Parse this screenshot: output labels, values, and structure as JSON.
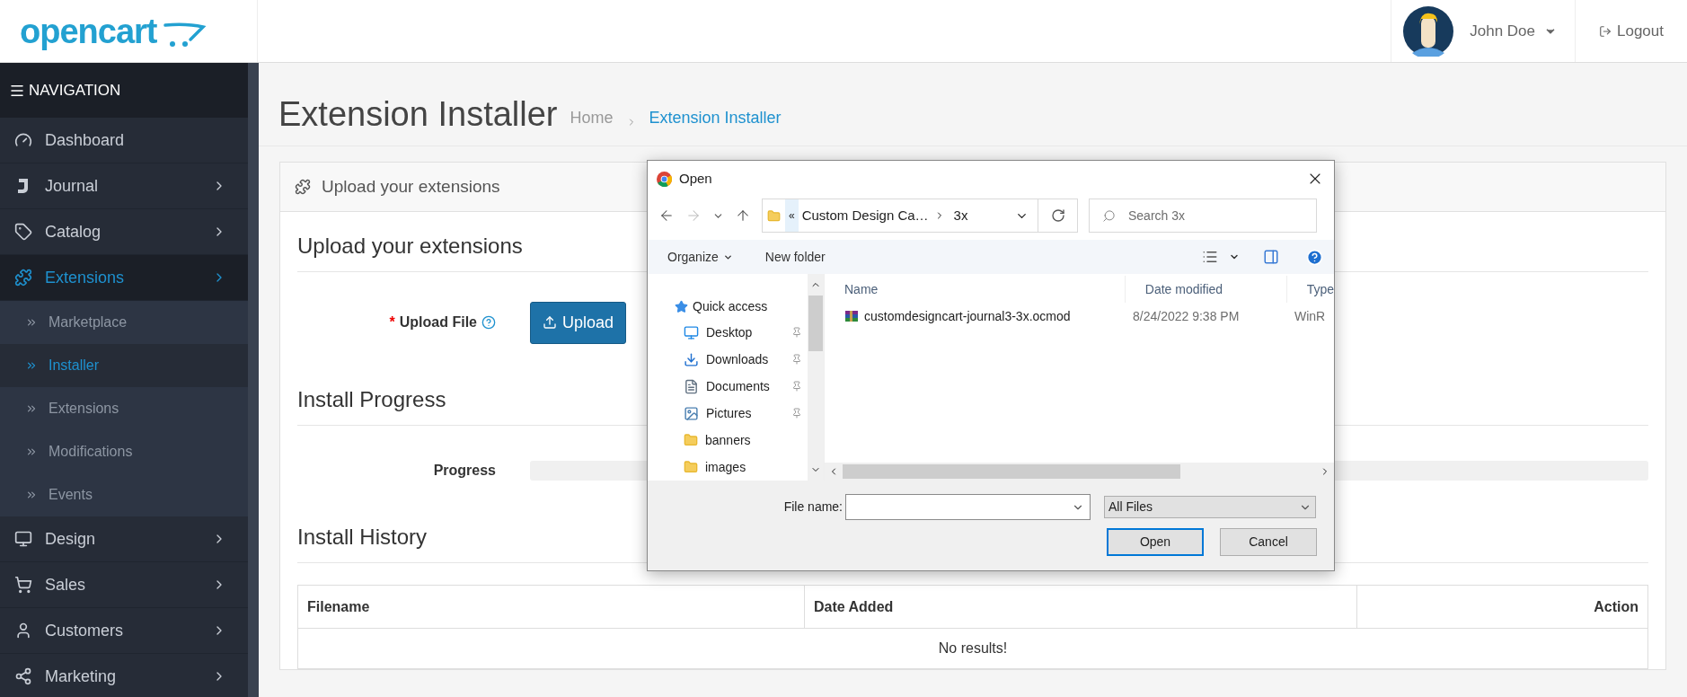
{
  "header": {
    "logo": "opencart",
    "user": "John Doe",
    "logout": "Logout"
  },
  "sidebar": {
    "heading": "NAVIGATION",
    "items": [
      {
        "label": "Dashboard",
        "selected": false,
        "has_arrow": false
      },
      {
        "label": "Journal",
        "selected": false,
        "has_arrow": true
      },
      {
        "label": "Catalog",
        "selected": false,
        "has_arrow": true
      },
      {
        "label": "Extensions",
        "selected": true,
        "has_arrow": true,
        "children": [
          {
            "label": "Marketplace",
            "selected": false
          },
          {
            "label": "Installer",
            "selected": true
          },
          {
            "label": "Extensions",
            "selected": false
          },
          {
            "label": "Modifications",
            "selected": false
          },
          {
            "label": "Events",
            "selected": false
          }
        ]
      },
      {
        "label": "Design",
        "selected": false,
        "has_arrow": true
      },
      {
        "label": "Sales",
        "selected": false,
        "has_arrow": true
      },
      {
        "label": "Customers",
        "selected": false,
        "has_arrow": true
      },
      {
        "label": "Marketing",
        "selected": false,
        "has_arrow": true
      }
    ]
  },
  "page": {
    "title": "Extension Installer",
    "breadcrumbs": [
      {
        "label": "Home",
        "selected": false
      },
      {
        "label": "Extension Installer",
        "selected": true
      }
    ],
    "panel": {
      "title": "Upload your extensions",
      "upload": {
        "heading": "Upload your extensions",
        "label": "Upload File",
        "required_mark": "*",
        "button": "Upload"
      },
      "progress": {
        "heading": "Install Progress",
        "label": "Progress",
        "level": 0
      },
      "history": {
        "heading": "Install History",
        "columns": [
          "Filename",
          "Date Added",
          "Action"
        ],
        "empty": "No results!"
      }
    }
  },
  "dialog": {
    "title": "Open",
    "overflow": "«",
    "path": [
      "Custom Design Ca…",
      "3x"
    ],
    "search": {
      "placeholder": "Search 3x"
    },
    "toolbar": [
      "Organize",
      "New folder"
    ],
    "tree": [
      {
        "label": "Quick access",
        "children": [
          {
            "label": "Desktop",
            "pinned": true
          },
          {
            "label": "Downloads",
            "pinned": true
          },
          {
            "label": "Documents",
            "pinned": true
          },
          {
            "label": "Pictures",
            "pinned": true
          },
          {
            "label": "banners",
            "pinned": false
          },
          {
            "label": "images",
            "pinned": false
          }
        ]
      }
    ],
    "columns": [
      "Name",
      "Date modified",
      "Type"
    ],
    "files": [
      {
        "name": "customdesigncart-journal3-3x.ocmod",
        "date": "8/24/2022 9:38 PM",
        "type": "WinR"
      }
    ],
    "file_name": {
      "label": "File name:"
    },
    "filter": "All Files",
    "buttons": [
      {
        "label": "Open",
        "selected": true
      },
      {
        "label": "Cancel",
        "selected": false
      }
    ]
  }
}
